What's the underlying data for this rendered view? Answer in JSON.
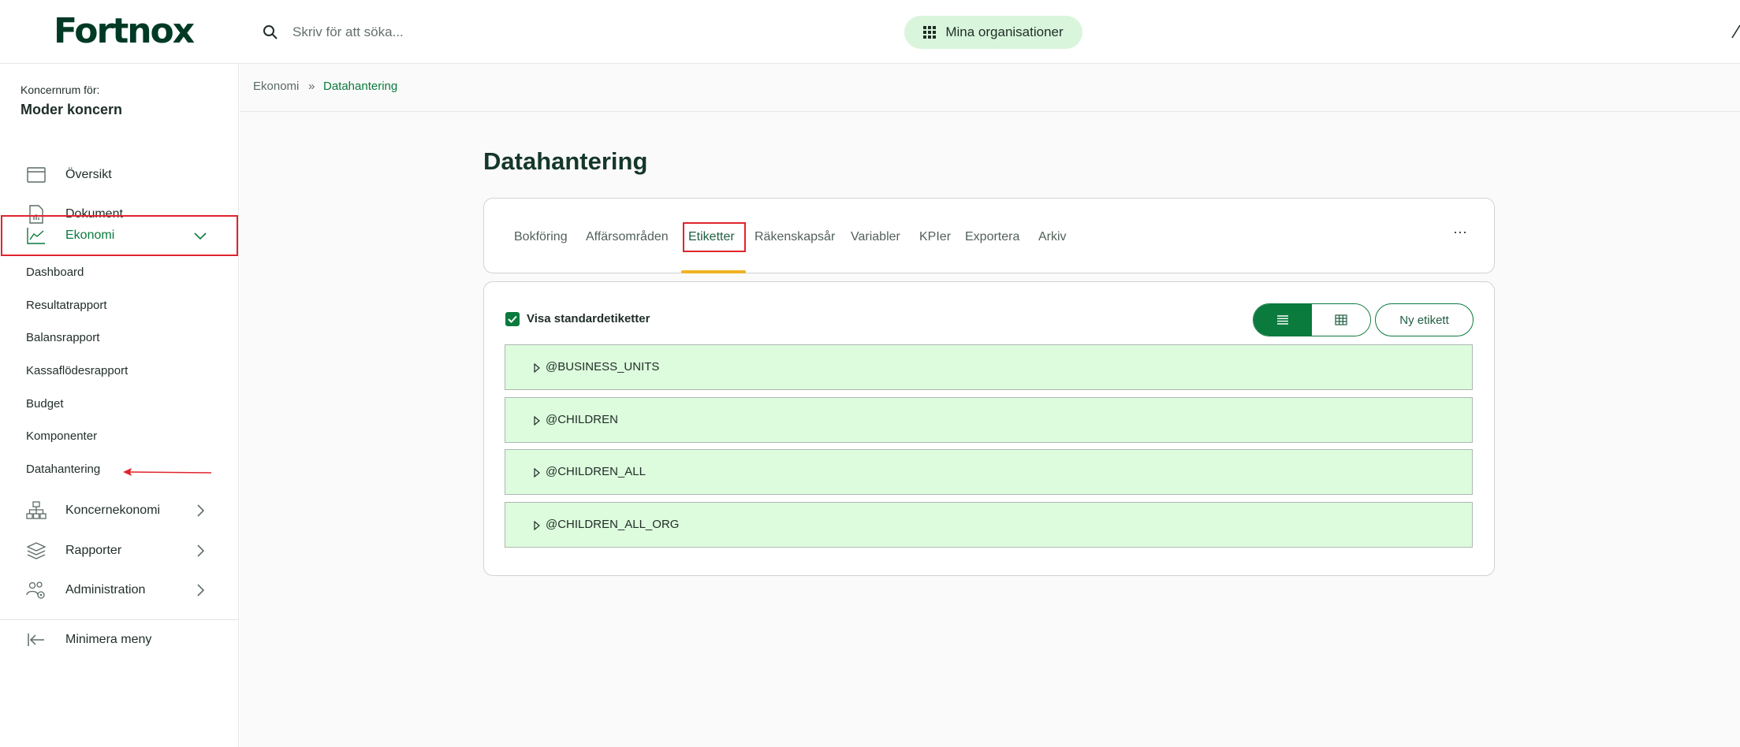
{
  "header": {
    "logo": "Fortnox",
    "search_placeholder": "Skriv för att söka...",
    "orgs_button": "Mina organisationer"
  },
  "sidebar": {
    "subtitle": "Koncernrum för:",
    "title": "Moder koncern",
    "items": [
      {
        "label": "Översikt"
      },
      {
        "label": "Dokument"
      },
      {
        "label": "Ekonomi"
      }
    ],
    "ekonomi_sub": [
      {
        "label": "Dashboard"
      },
      {
        "label": "Resultatrapport"
      },
      {
        "label": "Balansrapport"
      },
      {
        "label": "Kassaflödesrapport"
      },
      {
        "label": "Budget"
      },
      {
        "label": "Komponenter"
      },
      {
        "label": "Datahantering"
      }
    ],
    "items_after": [
      {
        "label": "Koncernekonomi"
      },
      {
        "label": "Rapporter"
      },
      {
        "label": "Administration"
      }
    ],
    "minimize": "Minimera meny"
  },
  "breadcrumb": {
    "parent": "Ekonomi",
    "separator": "»",
    "current": "Datahantering"
  },
  "page": {
    "title": "Datahantering"
  },
  "tabs": [
    {
      "label": "Bokföring"
    },
    {
      "label": "Affärsområden"
    },
    {
      "label": "Etiketter"
    },
    {
      "label": "Räkenskapsår"
    },
    {
      "label": "Variabler"
    },
    {
      "label": "KPIer"
    },
    {
      "label": "Exportera"
    },
    {
      "label": "Arkiv"
    }
  ],
  "tab_more": "···",
  "content": {
    "checkbox_label": "Visa standardetiketter",
    "checkbox_checked": true,
    "new_button": "Ny etikett",
    "rows": [
      {
        "label": "@BUSINESS_UNITS"
      },
      {
        "label": "@CHILDREN"
      },
      {
        "label": "@CHILDREN_ALL"
      },
      {
        "label": "@CHILDREN_ALL_ORG"
      }
    ]
  },
  "colors": {
    "brand": "#003a25",
    "accent": "#0a7a3d",
    "row_bg": "#ddfbdd",
    "annotation": "#e0242c",
    "tab_underline": "#f0b323"
  }
}
